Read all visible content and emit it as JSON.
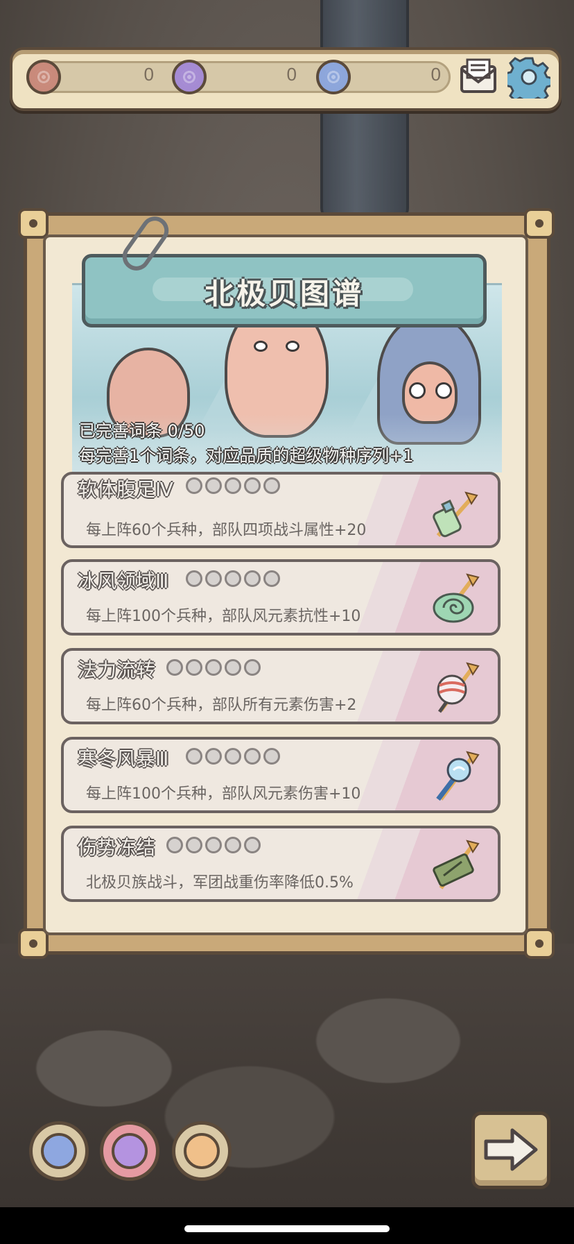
{
  "resources": [
    {
      "name": "red-brain-token",
      "count": "0",
      "color": "#c98a7b"
    },
    {
      "name": "purple-brain-token",
      "count": "0",
      "color": "#a58bd3"
    },
    {
      "name": "blue-brain-token",
      "count": "0",
      "color": "#8da6db"
    }
  ],
  "panel": {
    "title": "北极贝图谱",
    "progress_text": "已完善词条 0/50",
    "hint_text": "每完善1个词条，对应品质的超级物种序列+1"
  },
  "entries": [
    {
      "name": "软体腹足Ⅳ",
      "desc": "每上阵60个兵种，部队四项战斗属性+20",
      "icon": "bottle-icon",
      "stars": 0
    },
    {
      "name": "冰风领域Ⅲ",
      "desc": "每上阵100个兵种，部队风元素抗性+10",
      "icon": "snail-shell-icon",
      "stars": 0
    },
    {
      "name": "法力流转",
      "desc": "每上阵60个兵种，部队所有元素伤害+2",
      "icon": "striped-orb-icon",
      "stars": 0
    },
    {
      "name": "寒冬风暴Ⅲ",
      "desc": "每上阵100个兵种，部队风元素伤害+10",
      "icon": "magic-scepter-icon",
      "stars": 0
    },
    {
      "name": "伤势冻结",
      "desc": "北极贝族战斗，军团战重伤率降低0.5%",
      "icon": "bandage-icon",
      "stars": 0
    }
  ],
  "bottom_buttons": [
    {
      "name": "blue-orb-button",
      "color": "#8ea7e0"
    },
    {
      "name": "purple-orb-button",
      "color": "#b493e0"
    },
    {
      "name": "orange-orb-button",
      "color": "#f0c08a"
    }
  ],
  "colors": {
    "frame": "#c9a979",
    "outline": "#5b4a3a",
    "banner": "#8fc3c3",
    "entry_accent": "#e6c9d3"
  }
}
